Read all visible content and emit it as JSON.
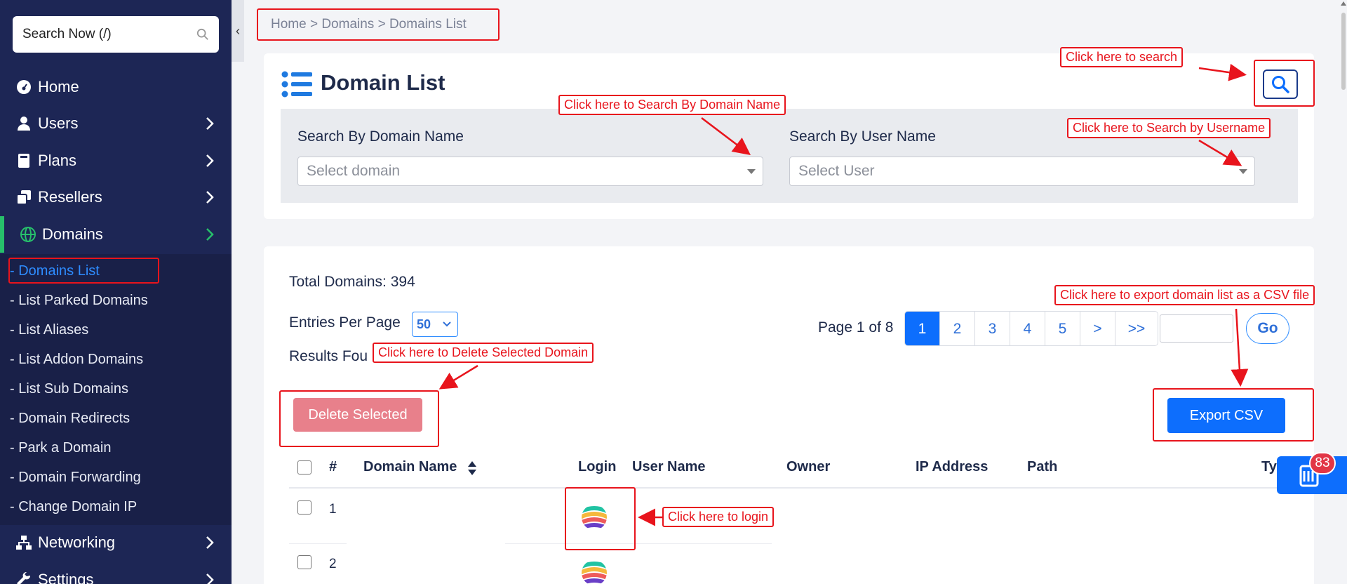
{
  "sidebar": {
    "search_placeholder": "Search Now (/)",
    "nav": [
      {
        "label": "Home",
        "icon": "dashboard-icon"
      },
      {
        "label": "Users",
        "icon": "user-icon"
      },
      {
        "label": "Plans",
        "icon": "book-icon"
      },
      {
        "label": "Resellers",
        "icon": "copy-icon"
      },
      {
        "label": "Domains",
        "icon": "globe-icon"
      },
      {
        "label": "Networking",
        "icon": "network-icon"
      },
      {
        "label": "Settings",
        "icon": "wrench-icon"
      }
    ],
    "domains_sub": [
      "- Domains List",
      "- List Parked Domains",
      "- List Aliases",
      "- List Addon Domains",
      "- List Sub Domains",
      "- Domain Redirects",
      "- Park a Domain",
      "- Domain Forwarding",
      "- Change Domain IP"
    ],
    "collapse_glyph": "‹"
  },
  "breadcrumb": "Home > Domains > Domains List",
  "page_title": "Domain List",
  "filters": {
    "domain_label": "Search By Domain Name",
    "domain_placeholder": "Select domain",
    "user_label": "Search By User Name",
    "user_placeholder": "Select User"
  },
  "summary": {
    "total": "Total Domains: 394",
    "entries_label": "Entries Per Page",
    "entries_value": "50",
    "results_label": "Results Fou"
  },
  "pagination": {
    "info": "Page 1 of 8",
    "pages": [
      "1",
      "2",
      "3",
      "4",
      "5",
      ">",
      ">>"
    ],
    "go_label": "Go"
  },
  "actions": {
    "delete_label": "Delete Selected",
    "export_label": "Export CSV"
  },
  "table": {
    "headers": [
      "#",
      "Domain Name",
      "Login",
      "User Name",
      "Owner",
      "IP Address",
      "Path",
      "Ty"
    ],
    "rows": [
      "1",
      "2"
    ]
  },
  "notification_count": "83",
  "annotations": {
    "search": "Click here to search",
    "domain": "Click here to Search By Domain Name",
    "username": "Click here to Search by Username",
    "export": "Click here to export domain list as a CSV file",
    "delete": "Click here to Delete Selected Domain",
    "login": "Click here to login"
  },
  "colors": {
    "sidebar": "#1d2655",
    "accent": "#0d6efd",
    "annotation": "#e8141c",
    "delete": "#e8808b"
  }
}
